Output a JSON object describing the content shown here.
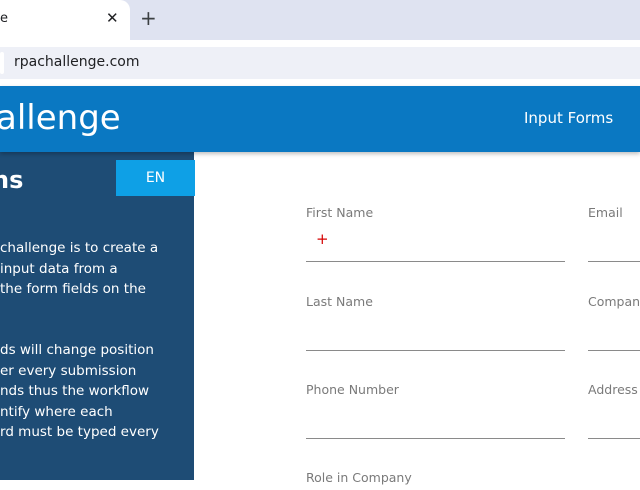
{
  "browser": {
    "tab_title": "e",
    "tab_close": "✕",
    "new_tab": "+",
    "url": "rpachallenge.com"
  },
  "header": {
    "brand": "allenge",
    "nav_link": "Input Forms"
  },
  "sidebar": {
    "title": "ns",
    "language_button": "EN",
    "description_1": [
      "challenge is to create a",
      "input data from a",
      "the form fields on the"
    ],
    "description_2": [
      "ds will change position",
      "er every submission",
      "nds thus the workflow",
      "ntify where each",
      "rd must be typed every"
    ]
  },
  "form": {
    "first_name_label": "First Name",
    "email_label": "Email",
    "last_name_label": "Last Name",
    "company_label": "Compan",
    "phone_label": "Phone Number",
    "address_label": "Address",
    "role_label": "Role in Company",
    "required_marker": "+"
  }
}
